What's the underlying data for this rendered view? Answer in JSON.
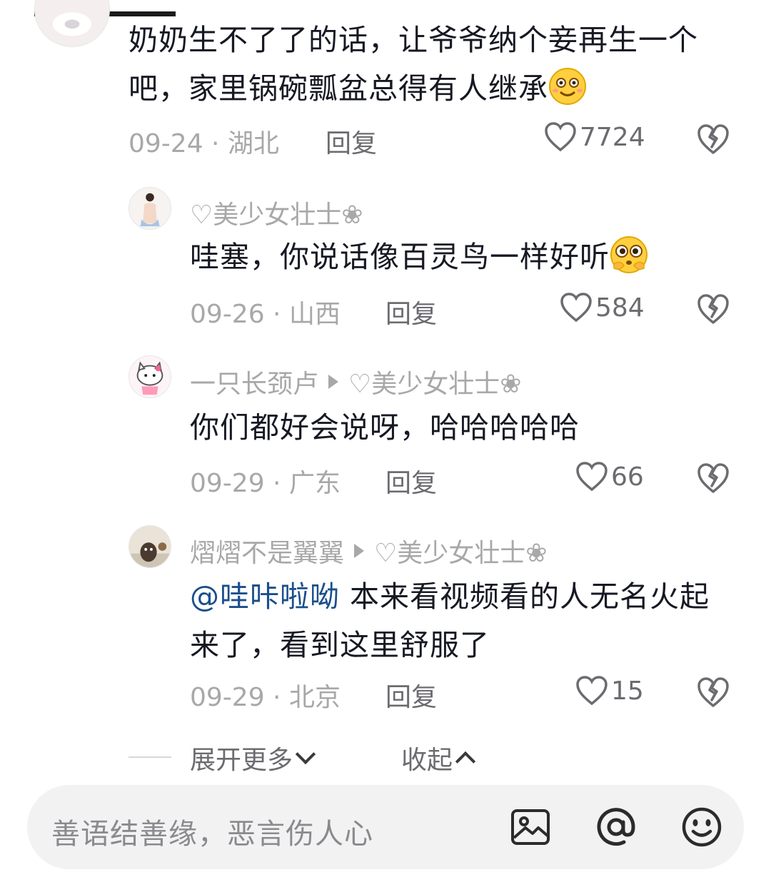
{
  "comments": [
    {
      "text": "奶奶生不了了的话，让爷爷纳个妾再生一个吧，家里锅碗瓢盆总得有人继承",
      "date_loc": "09-24 · 湖北",
      "reply": "回复",
      "likes": "7724",
      "emoji": "smiling-face-icon"
    },
    {
      "username": "♡美少女壮士❀",
      "text": "哇塞，你说话像百灵鸟一样好听",
      "date_loc": "09-26 · 山西",
      "reply": "回复",
      "likes": "584",
      "emoji": "pleading-face-icon"
    },
    {
      "username": "一只长颈卢",
      "reply_to": "♡美少女壮士❀",
      "text": "你们都好会说呀，哈哈哈哈哈",
      "date_loc": "09-29 · 广东",
      "reply": "回复",
      "likes": "66"
    },
    {
      "username": "熠熠不是翼翼",
      "reply_to": "♡美少女壮士❀",
      "mention": "@哇咔啦呦",
      "text": " 本来看视频看的人无名火起来了，看到这里舒服了",
      "date_loc": "09-29 · 北京",
      "reply": "回复",
      "likes": "15"
    }
  ],
  "footer": {
    "expand_more": "展开更多",
    "collapse": "收起"
  },
  "input": {
    "placeholder": "善语结善缘，恶言伤人心"
  },
  "colors": {
    "mention": "#1a4f8c",
    "muted": "#a8a8a8",
    "input_bg": "#f2f2f3"
  }
}
